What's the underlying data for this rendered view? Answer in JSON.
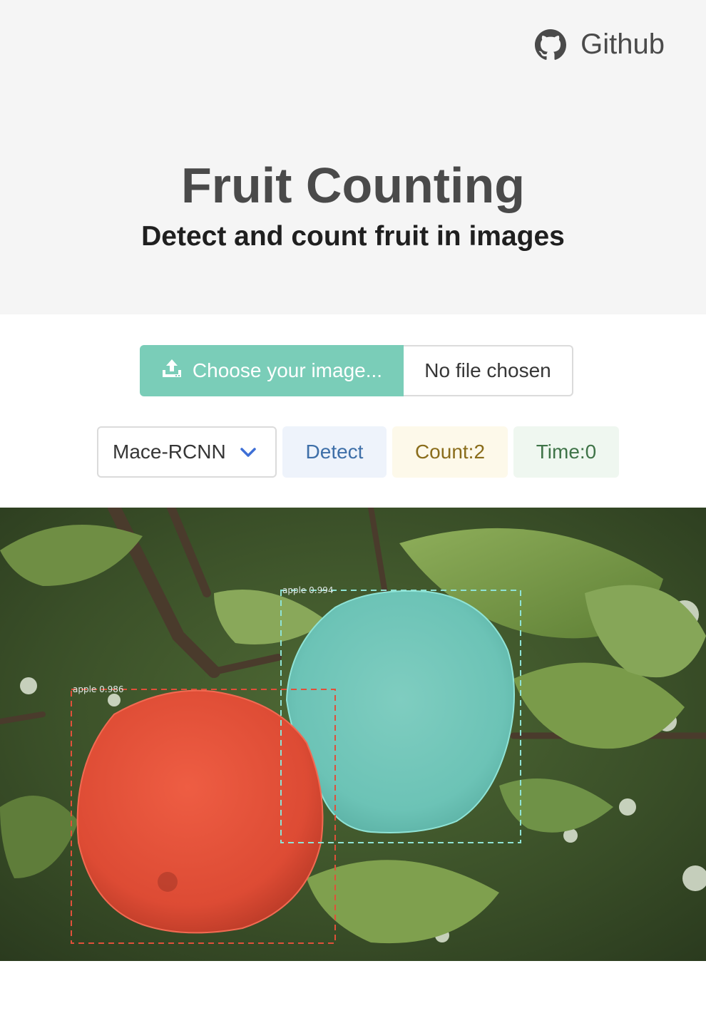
{
  "nav": {
    "github_label": "Github",
    "github_icon": "github-icon"
  },
  "hero": {
    "title": "Fruit Counting",
    "subtitle": "Detect and count fruit in images"
  },
  "upload": {
    "button_label": "Choose your image...",
    "button_icon": "upload-icon",
    "file_name": "No file chosen"
  },
  "controls": {
    "model_selected": "Mace-RCNN",
    "detect_label": "Detect",
    "count_label": "Count:2",
    "time_label": "Time:0"
  },
  "detections": [
    {
      "label": "apple 0.994",
      "class": "apple",
      "score": 0.994,
      "color": "#6fd3c8"
    },
    {
      "label": "apple 0.986",
      "class": "apple",
      "score": 0.986,
      "color": "#e0503a"
    }
  ],
  "colors": {
    "hero_bg": "#f5f5f5",
    "primary": "#7acdb8",
    "detect_bg": "#eef3fb",
    "count_bg": "#fdf9ea",
    "time_bg": "#eff7f0"
  }
}
